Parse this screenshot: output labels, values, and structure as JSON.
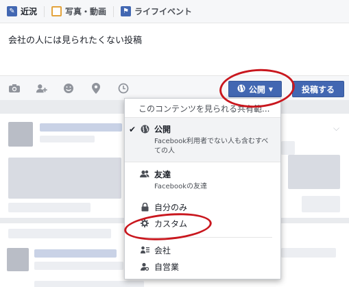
{
  "tabs": [
    {
      "label": "近況",
      "icon": "pencil-icon"
    },
    {
      "label": "写真・動画",
      "icon": "photo-icon"
    },
    {
      "label": "ライフイベント",
      "icon": "flag-icon"
    }
  ],
  "composer": {
    "text": "会社の人には見られたくない投稿"
  },
  "toolbar": {
    "privacy_label": "公開",
    "post_label": "投稿する"
  },
  "dropdown": {
    "header": "このコンテンツを見られる共有範...",
    "public": {
      "title": "公開",
      "desc": "Facebook利用者でない人も含むすべての人"
    },
    "friends": {
      "title": "友達",
      "desc": "Facebookの友達"
    },
    "only_me": "自分のみ",
    "custom": "カスタム",
    "company": "会社",
    "self_employed": "自営業"
  },
  "colors": {
    "accent": "#4267b2",
    "annotation": "#c9171e"
  }
}
